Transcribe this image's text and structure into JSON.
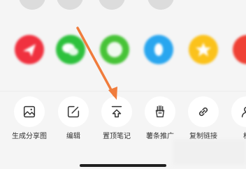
{
  "top_row": {
    "items": [
      {
        "label": "",
        "icon": "blurred-icon"
      },
      {
        "label": "",
        "icon": "blurred-icon"
      },
      {
        "label": "",
        "icon": "blurred-icon"
      },
      {
        "label": "",
        "icon": "blurred-icon"
      }
    ]
  },
  "share_row": {
    "items": [
      {
        "label": "",
        "icon": "send-icon",
        "color": "#f0313f"
      },
      {
        "label": "",
        "icon": "wechat-icon",
        "color": "#2dc13d"
      },
      {
        "label": "",
        "icon": "moments-icon",
        "color": "#47c337"
      },
      {
        "label": "",
        "icon": "qq-icon",
        "color": "#29a6ef"
      },
      {
        "label": "",
        "icon": "qzone-icon",
        "color": "#fbc21b"
      },
      {
        "label": "",
        "icon": "weibo-icon",
        "color": "#ef4135"
      }
    ]
  },
  "actions": {
    "items": [
      {
        "label": "生成分享图",
        "icon": "image-icon"
      },
      {
        "label": "编辑",
        "icon": "edit-icon"
      },
      {
        "label": "置顶笔记",
        "icon": "pin-top-icon"
      },
      {
        "label": "薯条推广",
        "icon": "fries-icon"
      },
      {
        "label": "复制链接",
        "icon": "link-icon"
      },
      {
        "label": "权",
        "icon": "user-icon"
      }
    ]
  },
  "annotation": {
    "color": "#f07c3c",
    "icon": "arrow-icon"
  },
  "colors": {
    "sheet_bg": "#f5f5f5",
    "action_circle": "#ffffff",
    "label_text": "#333333"
  }
}
